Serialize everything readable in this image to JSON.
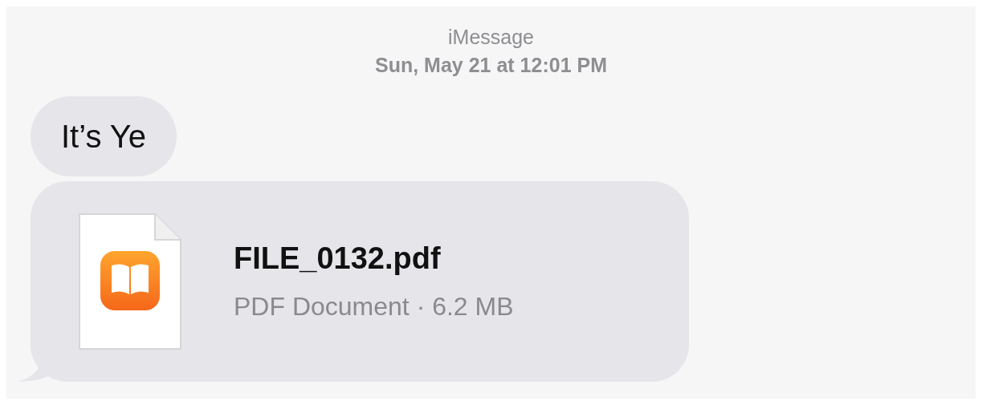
{
  "header": {
    "service": "iMessage",
    "timestamp": "Sun, May 21 at 12:01 PM"
  },
  "messages": [
    {
      "kind": "text",
      "text": "It’s Ye"
    },
    {
      "kind": "file",
      "filename": "FILE_0132.pdf",
      "details": "PDF Document · 6.2 MB"
    }
  ]
}
